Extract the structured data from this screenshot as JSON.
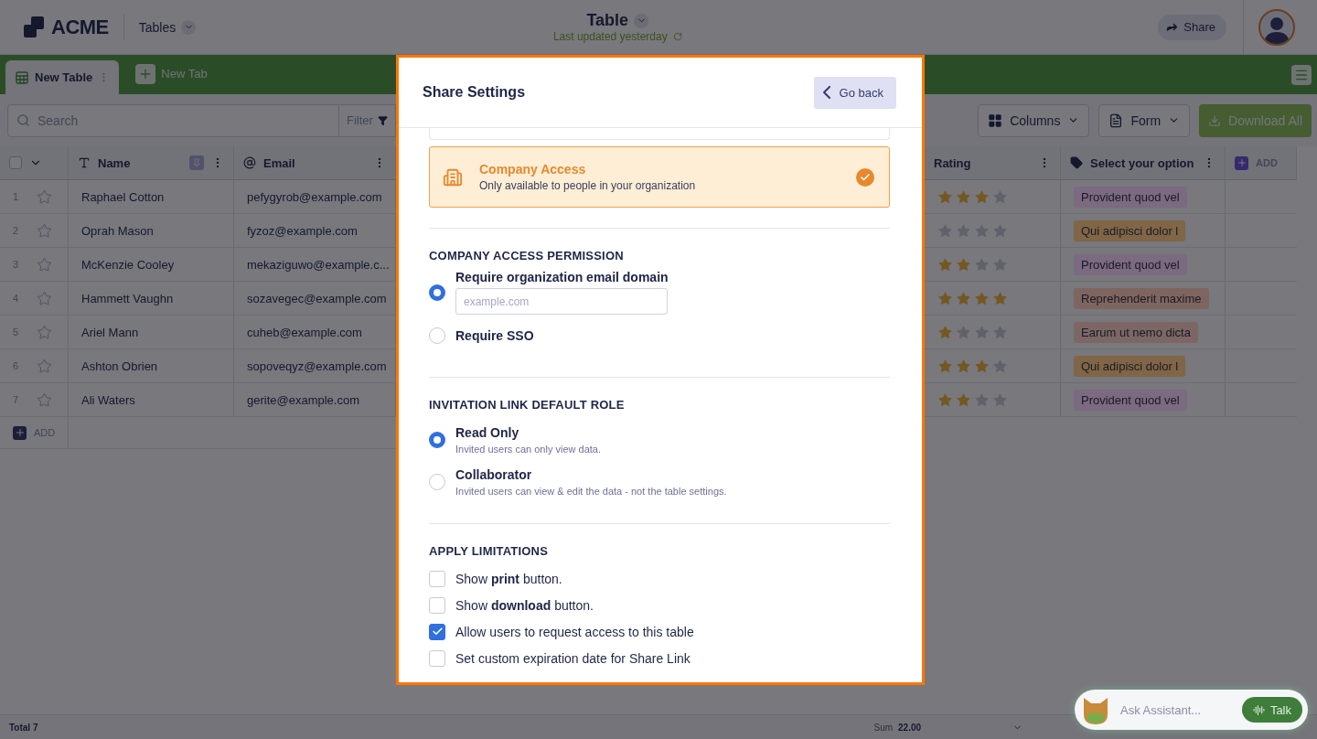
{
  "header": {
    "logo": "ACME",
    "nav": "Tables",
    "title": "Table",
    "subtitle": "Last updated yesterday",
    "share": "Share"
  },
  "tabs": [
    {
      "label": "New Table",
      "selected": true
    },
    {
      "label": "New Tab",
      "selected": false
    }
  ],
  "toolbar": {
    "search_placeholder": "Search",
    "filter": "Filter",
    "buttons": [
      "Columns",
      "Form"
    ],
    "download": "Download All"
  },
  "table": {
    "columns": [
      {
        "kind": "text",
        "label": "Name"
      },
      {
        "kind": "email",
        "label": "Email"
      },
      {
        "kind": "rating",
        "label": "Rating"
      },
      {
        "kind": "option",
        "label": "Select your option"
      }
    ],
    "add_column": "ADD",
    "all_checked": false,
    "rows": [
      {
        "number": "1",
        "starred": false,
        "name": "Raphael Cotton",
        "email": "pefygyrob@example.com",
        "stars": 3,
        "option": {
          "label": "Provident quod vel",
          "color": "#7b6a80"
        }
      },
      {
        "number": "2",
        "starred": false,
        "name": "Oprah Mason",
        "email": "fyzoz@example.com",
        "stars": 0,
        "option": {
          "label": "Qui adipisci dolor l",
          "color": "#806646"
        }
      },
      {
        "number": "3",
        "starred": false,
        "name": "McKenzie Cooley",
        "email": "mekaziguwo@example.c...",
        "stars": 2,
        "option": {
          "label": "Provident quod vel",
          "color": "#7b6a80"
        }
      },
      {
        "number": "4",
        "starred": false,
        "name": "Hammett Vaughn",
        "email": "sozavegec@example.com",
        "stars": 4,
        "option": {
          "label": "Reprehenderit maxime",
          "color": "#7f6560"
        }
      },
      {
        "number": "5",
        "starred": false,
        "name": "Ariel Mann",
        "email": "cuheb@example.com",
        "stars": 1,
        "option": {
          "label": "Earum ut nemo dicta",
          "color": "#7c6764"
        }
      },
      {
        "number": "6",
        "starred": false,
        "name": "Ashton Obrien",
        "email": "sopoveqyz@example.com",
        "stars": 3,
        "option": {
          "label": "Qui adipisci dolor l",
          "color": "#806646"
        }
      },
      {
        "number": "7",
        "starred": false,
        "name": "Ali Waters",
        "email": "gerite@example.com",
        "stars": 2,
        "option": {
          "label": "Provident quod vel",
          "color": "#7b6a80"
        }
      }
    ],
    "add_row": "ADD"
  },
  "footer": {
    "total": "Total 7",
    "sum_label": "Sum",
    "sum_value": "22.00"
  },
  "assistant": {
    "placeholder": "Ask Assistant...",
    "talk": "Talk"
  },
  "modal": {
    "title": "Share Settings",
    "back": "Go back",
    "access_option": {
      "title": "Company Access",
      "description": "Only available to people in your organization",
      "selected": true
    },
    "sections": [
      {
        "kind": "radio",
        "heading": "COMPANY ACCESS PERMISSION",
        "options": [
          {
            "label": "Require organization email domain",
            "selected": true,
            "placeholder": "example.com"
          },
          {
            "label": "Require SSO",
            "selected": false
          }
        ]
      },
      {
        "kind": "radio",
        "heading": "INVITATION LINK DEFAULT ROLE",
        "options": [
          {
            "label": "Read Only",
            "description": "Invited users can only view data.",
            "selected": true
          },
          {
            "label": "Collaborator",
            "description": "Invited users can view & edit the data - not the table settings.",
            "selected": false
          }
        ]
      },
      {
        "kind": "checkbox",
        "heading": "APPLY LIMITATIONS",
        "options": [
          {
            "label": "Show **print** button.",
            "checked": false
          },
          {
            "label": "Show **download** button.",
            "checked": false
          },
          {
            "label": "Allow users to request access to this table",
            "checked": true
          },
          {
            "label": "Set custom expiration date for Share Link",
            "checked": false
          }
        ]
      }
    ]
  }
}
